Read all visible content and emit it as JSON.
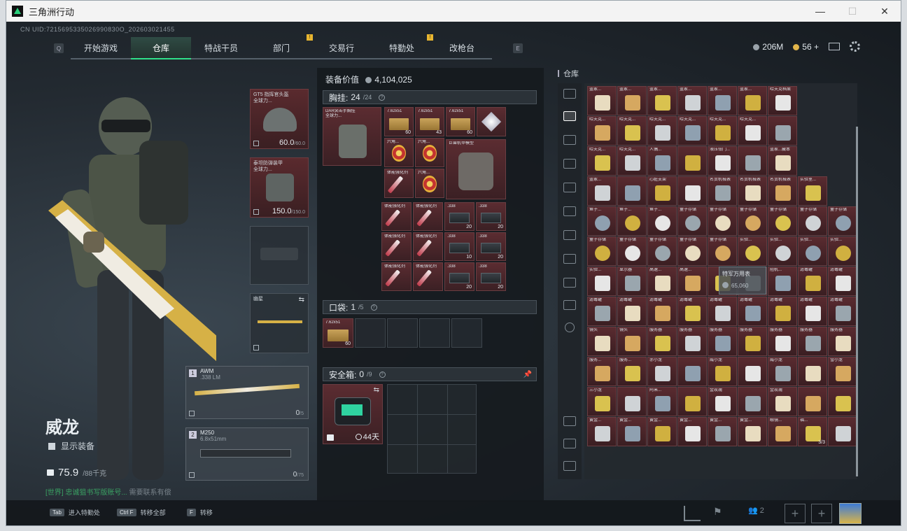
{
  "window": {
    "title": "三角洲行动",
    "minimize": "—",
    "maximize": "☐",
    "close": "✕"
  },
  "uid": "CN UID:7215695335026990830O_202603021455",
  "nav": {
    "key_left": "Q",
    "key_right": "E",
    "tabs": [
      {
        "label": "开始游戏",
        "badge": ""
      },
      {
        "label": "仓库",
        "badge": ""
      },
      {
        "label": "特战干员",
        "badge": ""
      },
      {
        "label": "部门",
        "badge": "!"
      },
      {
        "label": "交易行",
        "badge": ""
      },
      {
        "label": "特勤处",
        "badge": "!"
      },
      {
        "label": "改枪台",
        "badge": ""
      }
    ]
  },
  "currency": {
    "money": "206M",
    "coins": "56 +",
    "money_color": "#9aa3aa",
    "coin_color": "#e2b54a"
  },
  "character": {
    "name": "威龙",
    "show_equipment": "显示装备",
    "weight": "75.9",
    "weight_max": "/88千克",
    "chat_channel": "[世界]",
    "chat_text": "忠诚狙书写版账号...",
    "chat_tail": "需要联系有偿"
  },
  "equipment": {
    "helmet": {
      "label": "GT5 指挥官头盔\n全球力...",
      "durability": "60.0",
      "max": "/60.0"
    },
    "armor": {
      "label": "泰坦防弹装甲\n全球力...",
      "durability": "150.0",
      "max": "/150.0"
    },
    "melee": {
      "label": "幽星"
    },
    "primary": {
      "num": "1",
      "name": "AWM",
      "caliber": ".338 LM",
      "ammo": "0",
      "ammo_max": "/5"
    },
    "secondary": {
      "num": "2",
      "name": "M250",
      "caliber": "6.8x51mm",
      "ammo": "0",
      "ammo_max": "/75"
    }
  },
  "inventory": {
    "equip_value_label": "装备价值",
    "equip_value": "4,104,025",
    "chest": {
      "title": "胸挂:",
      "count": "24",
      "max": "/24",
      "vest_label": "DAR突击手胸挂\n全球力..."
    },
    "pocket": {
      "title": "口袋:",
      "count": "1",
      "max": "/5"
    },
    "safebox": {
      "title": "安全箱:",
      "count": "0",
      "max": "/9",
      "days": "44天"
    },
    "chest_items": [
      {
        "t": "7.62x51",
        "n": "60",
        "kind": "box"
      },
      {
        "t": "7.62x51",
        "n": "43",
        "kind": "box"
      },
      {
        "t": "7.62x51",
        "n": "60",
        "kind": "box"
      },
      {
        "t": "",
        "n": "",
        "kind": "diamond"
      },
      {
        "t": "六角...",
        "n": "",
        "kind": "medal"
      },
      {
        "t": "六角...",
        "n": "",
        "kind": "medal"
      },
      {
        "t": "巨兽机甲模型",
        "n": "",
        "kind": "mech"
      },
      {
        "t": "体能强化剂",
        "n": "",
        "kind": "syringe"
      },
      {
        "t": "六角...",
        "n": "",
        "kind": "medal"
      }
    ],
    "backpack_items": [
      {
        "t": "体能强化剂",
        "n": "",
        "kind": "syringe"
      },
      {
        "t": "体能强化剂",
        "n": "",
        "kind": "syringe"
      },
      {
        "t": ".338",
        "n": "20",
        "kind": "ammo"
      },
      {
        "t": ".338",
        "n": "20",
        "kind": "ammo"
      },
      {
        "t": "体能强化剂",
        "n": "",
        "kind": "syringe"
      },
      {
        "t": "体能强化剂",
        "n": "",
        "kind": "syringe"
      },
      {
        "t": ".338",
        "n": "10",
        "kind": "ammo"
      },
      {
        "t": ".338",
        "n": "20",
        "kind": "ammo"
      },
      {
        "t": "体能强化剂",
        "n": "",
        "kind": "syringe"
      },
      {
        "t": "体能强化剂",
        "n": "",
        "kind": "syringe"
      },
      {
        "t": ".338",
        "n": "20",
        "kind": "ammo"
      },
      {
        "t": ".338",
        "n": "20",
        "kind": "ammo"
      }
    ],
    "pocket_items": [
      {
        "t": "7.62x51",
        "n": "60",
        "kind": "box"
      }
    ]
  },
  "warehouse": {
    "title": "仓库",
    "tooltip_name": "特军万用表",
    "tooltip_value": "65,060",
    "rows": [
      [
        "蓝家...",
        "蓝家...",
        "蓝家...",
        "蓝家...",
        "蓝家...",
        "蓝家...",
        "哈夫克档案"
      ],
      [
        "哈夫克...",
        "哈夫克...",
        "哈夫克...",
        "哈夫克...",
        "哈夫克...",
        "哈夫克...",
        ""
      ],
      [
        "哈夫克...",
        "哈夫克...",
        "人偶...",
        "",
        "液压钳门...",
        "",
        "蓝家...藏本"
      ],
      [
        "蓝家...",
        "",
        "心脏支架",
        "",
        "名贵机械表",
        "名贵机械表",
        "名贵机械表",
        "实验室..."
      ],
      [
        "鱼子...",
        "鱼子...",
        "鱼子...",
        "量子存储",
        "量子存储",
        "量子存储",
        "量子存储",
        "量子存储",
        "量子存储"
      ],
      [
        "量子存储",
        "量子存储",
        "量子存储",
        "量子存储",
        "量子存储",
        "实验...",
        "实验...",
        "实验...",
        "实验..."
      ],
      [
        "实验...",
        "显示器",
        "高速...",
        "高速...",
        "",
        "",
        "阻机...",
        "滤毒罐",
        "滤毒罐"
      ],
      [
        "滤毒罐",
        "滤毒罐",
        "滤毒罐",
        "滤毒罐",
        "滤毒罐",
        "滤毒罐",
        "滤毒罐",
        "滤毒罐",
        "滤毒罐"
      ],
      [
        "镜头",
        "镜头",
        "服务器",
        "服务器",
        "服务器",
        "服务器",
        "服务器",
        "服务器",
        "服务器"
      ],
      [
        "服务...",
        "服务...",
        "赤小龙",
        "",
        "威小龙",
        "",
        "威小龙",
        "",
        "雪小龙"
      ],
      [
        "三小龙",
        "",
        "阿米...",
        "",
        "金玫瑰",
        "",
        "金玫瑰",
        "",
        ""
      ],
      [
        "黄金...",
        "黄金...",
        "黄金...",
        "黄金...",
        "黄金...",
        "黄金...",
        "眼镜...",
        "福...",
        ""
      ]
    ],
    "last_count": "3/3"
  },
  "bottom": {
    "hints": [
      {
        "key": "Tab",
        "label": "进入特勤处"
      },
      {
        "key": "Ctrl F",
        "label": "转移全部"
      },
      {
        "key": "F",
        "label": "转移"
      }
    ],
    "squad_count": "2"
  }
}
